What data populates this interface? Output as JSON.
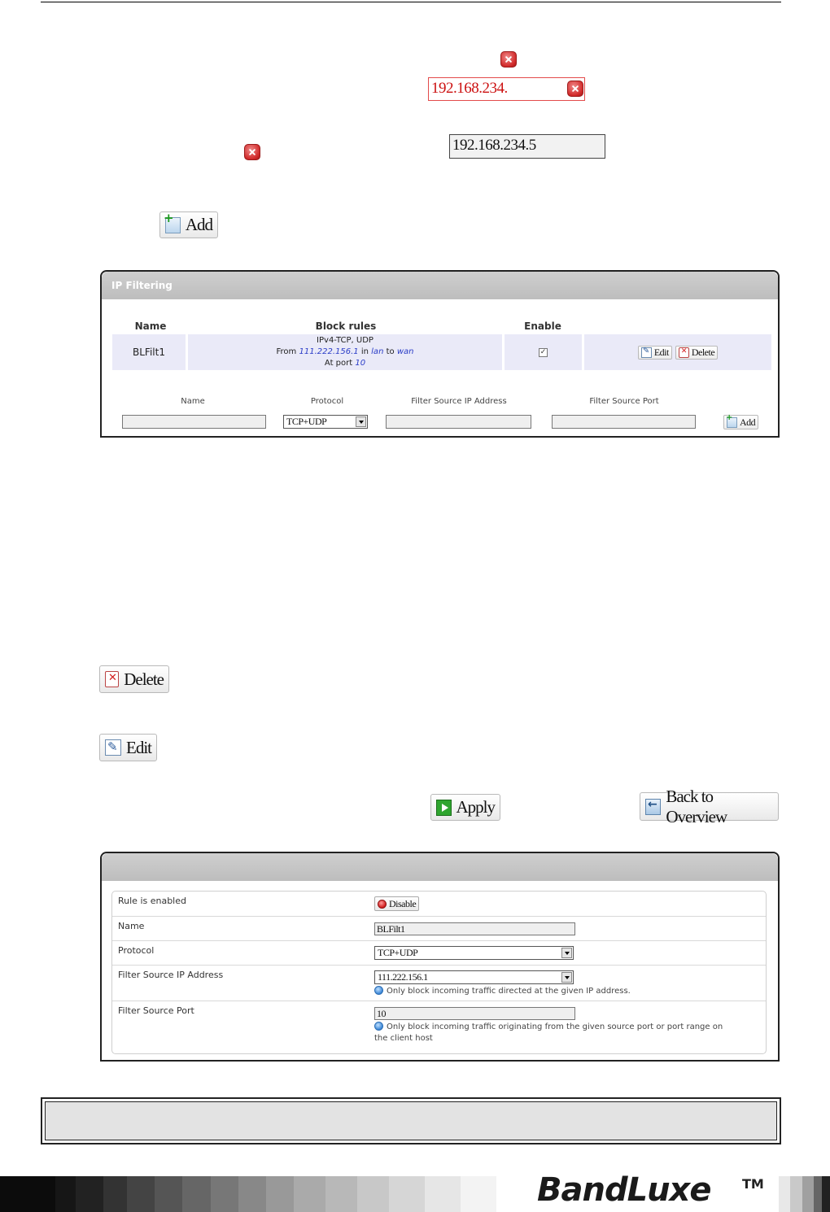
{
  "validation": {
    "invalid_ip_value": "192.168.234.",
    "valid_ip_value": "192.168.234.5"
  },
  "buttons": {
    "add": "Add",
    "delete": "Delete",
    "edit": "Edit",
    "apply": "Apply",
    "back_to_overview": "Back to Overview"
  },
  "ip_filtering": {
    "title": "IP Filtering",
    "columns": {
      "name": "Name",
      "block_rules": "Block rules",
      "enable": "Enable"
    },
    "rule": {
      "name": "BLFilt1",
      "line1": "IPv4-TCP, UDP",
      "from_label": "From",
      "from_ip": "111.222.156.1",
      "in_label": "in",
      "src_zone": "lan",
      "to_label": "to",
      "dest_zone": "wan",
      "port_label": "At port",
      "port": "10",
      "enabled": true,
      "edit_label": "Edit",
      "delete_label": "Delete"
    },
    "new_rule": {
      "name_label": "Name",
      "protocol_label": "Protocol",
      "src_ip_label": "Filter Source IP Address",
      "src_port_label": "Filter Source Port",
      "protocol_value": "TCP+UDP",
      "add_label": "Add"
    }
  },
  "edit_form": {
    "rows": {
      "enabled_label": "Rule is enabled",
      "disable_button": "Disable",
      "name_label": "Name",
      "name_value": "BLFilt1",
      "protocol_label": "Protocol",
      "protocol_value": "TCP+UDP",
      "src_ip_label": "Filter Source IP Address",
      "src_ip_value": "111.222.156.1",
      "src_ip_hint": "Only block incoming traffic directed at the given IP address.",
      "src_port_label": "Filter Source Port",
      "src_port_value": "10",
      "src_port_hint_1": "Only block incoming traffic originating from the given source port or port range on",
      "src_port_hint_2": "the client host"
    }
  },
  "footer": {
    "brand": "BandLuxe",
    "trademark": "TM"
  }
}
